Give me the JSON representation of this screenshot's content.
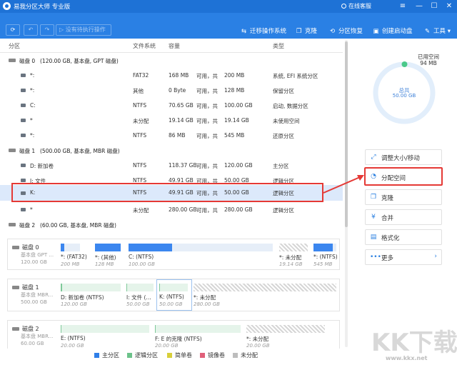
{
  "app": {
    "title": "易我分区大师 专业版",
    "support": "在线客服"
  },
  "toolbar": {
    "pending_label": "没有待执行操作",
    "actions": [
      {
        "icon": "migrate-icon",
        "label": "迁移操作系统"
      },
      {
        "icon": "clone-icon",
        "label": "克隆"
      },
      {
        "icon": "recover-icon",
        "label": "分区恢复"
      },
      {
        "icon": "bootdisk-icon",
        "label": "创建启动盘"
      },
      {
        "icon": "tools-icon",
        "label": "工具"
      }
    ]
  },
  "columns": {
    "partition": "分区",
    "fs": "文件系统",
    "capacity": "容量",
    "type": "类型"
  },
  "disks": [
    {
      "name": "磁盘 0",
      "info": "(120.00 GB, 基本盘, GPT 磁盘)",
      "partitions": [
        {
          "name": "*:",
          "fs": "FAT32",
          "used": "168 MB",
          "sep": "可用，共",
          "total": "200 MB",
          "type": "系统, EFI 系统分区"
        },
        {
          "name": "*:",
          "fs": "其他",
          "used": "0 Byte",
          "sep": "可用，共",
          "total": "128 MB",
          "type": "保留分区"
        },
        {
          "name": "C:",
          "fs": "NTFS",
          "used": "70.65 GB",
          "sep": "可用，共",
          "total": "100.00 GB",
          "type": "启动, 数据分区"
        },
        {
          "name": "*",
          "fs": "未分配",
          "used": "19.14 GB",
          "sep": "可用，共",
          "total": "19.14 GB",
          "type": "未使用空间"
        },
        {
          "name": "*:",
          "fs": "NTFS",
          "used": "86 MB",
          "sep": "可用，共",
          "total": "545 MB",
          "type": "还原分区"
        }
      ]
    },
    {
      "name": "磁盘 1",
      "info": "(500.00 GB, 基本盘, MBR 磁盘)",
      "partitions": [
        {
          "name": "D: 新加卷",
          "fs": "NTFS",
          "used": "118.37 GB",
          "sep": "可用，共",
          "total": "120.00 GB",
          "type": "主分区"
        },
        {
          "name": "I: 文件",
          "fs": "NTFS",
          "used": "49.91 GB",
          "sep": "可用，共",
          "total": "50.00 GB",
          "type": "逻辑分区"
        },
        {
          "name": "K:",
          "fs": "NTFS",
          "used": "49.91 GB",
          "sep": "可用，共",
          "total": "50.00 GB",
          "type": "逻辑分区"
        },
        {
          "name": "*",
          "fs": "未分配",
          "used": "280.00 GB",
          "sep": "可用，共",
          "total": "280.00 GB",
          "type": "逻辑分区"
        }
      ]
    },
    {
      "name": "磁盘 2",
      "info": "(60.00 GB, 基本盘, MBR 磁盘)",
      "partitions": []
    }
  ],
  "diskmaps": [
    {
      "label": "磁盘 0",
      "sub1": "基本盘 GPT ...",
      "sub2": "120.00 GB",
      "parts": [
        {
          "name": "*: (FAT32)",
          "size": "200 MB",
          "fill": 0.2,
          "kind": "primary"
        },
        {
          "name": "*: (其他)",
          "size": "128 MB",
          "fill": 1.0,
          "kind": "primary"
        },
        {
          "name": "C: (NTFS)",
          "size": "100.00 GB",
          "fill": 0.3,
          "kind": "primary"
        },
        {
          "name": "*: 未分配",
          "size": "19.14 GB",
          "fill": 0,
          "kind": "unallocated"
        },
        {
          "name": "*: (NTFS)",
          "size": "545 MB",
          "fill": 0.85,
          "kind": "primary"
        }
      ]
    },
    {
      "label": "磁盘 1",
      "sub1": "基本盘 MBR...",
      "sub2": "500.00 GB",
      "parts": [
        {
          "name": "D: 新加卷 (NTFS)",
          "size": "120.00 GB",
          "fill": 0.02,
          "kind": "logical"
        },
        {
          "name": "I: 文件 (...",
          "size": "50.00 GB",
          "fill": 0.01,
          "kind": "logical"
        },
        {
          "name": "K: (NTFS)",
          "size": "50.00 GB",
          "fill": 0.01,
          "kind": "logical"
        },
        {
          "name": "*: 未分配",
          "size": "280.00 GB",
          "fill": 0,
          "kind": "unallocated"
        }
      ]
    },
    {
      "label": "磁盘 2",
      "sub1": "基本盘 MBR...",
      "sub2": "60.00 GB",
      "parts": [
        {
          "name": "E: (NTFS)",
          "size": "20.00 GB",
          "fill": 0.01,
          "kind": "logical"
        },
        {
          "name": "F: E 的克隆 (NTFS)",
          "size": "20.00 GB",
          "fill": 0.01,
          "kind": "logical"
        },
        {
          "name": "*: 未分配",
          "size": "20.00 GB",
          "fill": 0,
          "kind": "unallocated"
        }
      ]
    }
  ],
  "legend": [
    {
      "label": "主分区",
      "color": "#2f7fe8"
    },
    {
      "label": "逻辑分区",
      "color": "#6cc28a"
    },
    {
      "label": "简单卷",
      "color": "#d8cf3a"
    },
    {
      "label": "镜像卷",
      "color": "#e0607a"
    },
    {
      "label": "未分配",
      "color": "#bdbdbd"
    }
  ],
  "summary": {
    "used_label": "已用空间",
    "used_value": "94 MB",
    "total_label": "总共",
    "total_value": "50.00 GB",
    "used_fraction": 0.002
  },
  "right_actions": [
    {
      "icon": "resize-icon",
      "label": "调整大小/移动",
      "active": false
    },
    {
      "icon": "allocate-icon",
      "label": "分配空间",
      "active": true
    },
    {
      "icon": "clone-icon",
      "label": "克隆",
      "active": false
    },
    {
      "icon": "merge-icon",
      "label": "合并",
      "active": false
    },
    {
      "icon": "format-icon",
      "label": "格式化",
      "active": false
    },
    {
      "icon": "more-icon",
      "label": "更多",
      "active": false
    }
  ],
  "watermark": {
    "text": "KK下载",
    "url": "www.kkx.net"
  },
  "colors": {
    "accent": "#2a80e4",
    "highlight": "#e53935",
    "selected_row": "#dce9fb"
  }
}
